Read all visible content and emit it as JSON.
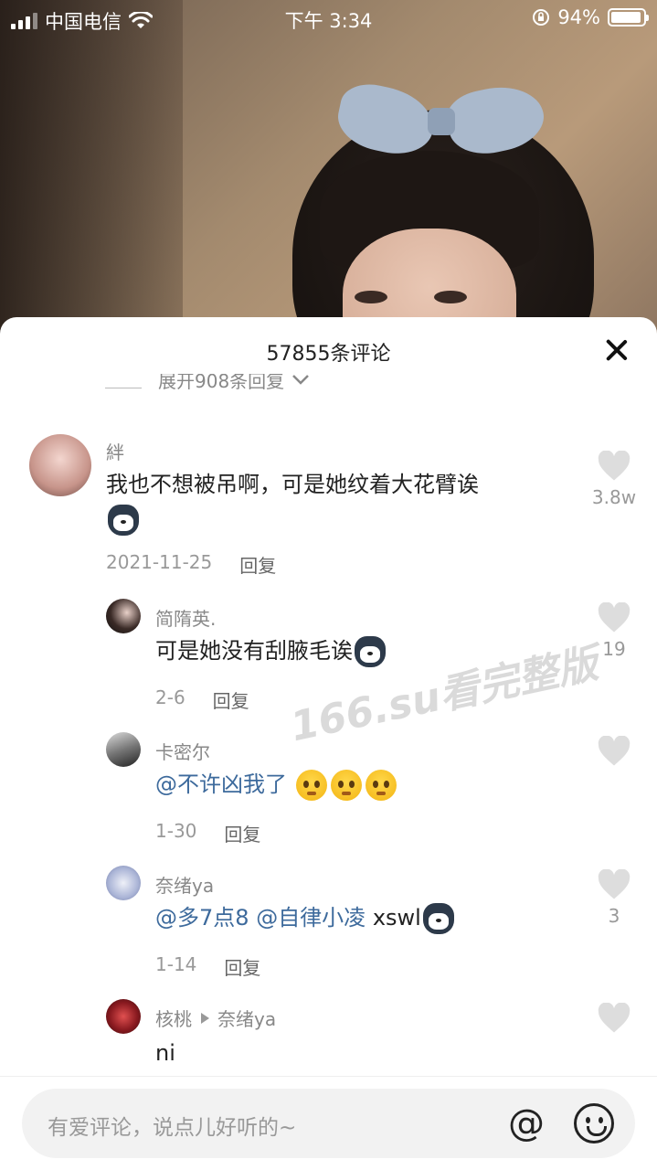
{
  "status_bar": {
    "carrier": "中国电信",
    "time": "下午 3:34",
    "battery": "94%",
    "battery_level": 0.94
  },
  "sheet": {
    "title": "57855条评论",
    "expand_replies": "展开908条回复"
  },
  "comments": [
    {
      "username": "絆",
      "text": "我也不想被吊啊，可是她纹着大花臂诶",
      "emoji": [
        "dog-emoji"
      ],
      "date": "2021-11-25",
      "reply_label": "回复",
      "likes": "3.8w"
    },
    {
      "username": "简隋英.",
      "text": "可是她没有刮腋毛诶",
      "emoji": [
        "dog-emoji"
      ],
      "date": "2-6",
      "reply_label": "回复",
      "likes": "19"
    },
    {
      "username": "卡密尔",
      "mention": "@不许凶我了",
      "emoji": [
        "pleading-face-emoji",
        "pleading-face-emoji",
        "crying-laughing-emoji"
      ],
      "date": "1-30",
      "reply_label": "回复",
      "likes": ""
    },
    {
      "username": "奈绪ya",
      "mention1": "@多7点8",
      "mention2": "@自律小凌",
      "text": "xswl",
      "emoji": [
        "dog-emoji"
      ],
      "date": "1-14",
      "reply_label": "回复",
      "likes": "3"
    },
    {
      "username": "核桃",
      "reply_to": "奈绪ya",
      "text": "ni",
      "likes": ""
    }
  ],
  "watermark": "166.su看完整版",
  "input": {
    "placeholder": "有爱评论，说点儿好听的~",
    "at_symbol": "@"
  },
  "colors": {
    "mention": "#3d6a9c",
    "text": "#222222",
    "secondary": "#888888"
  }
}
